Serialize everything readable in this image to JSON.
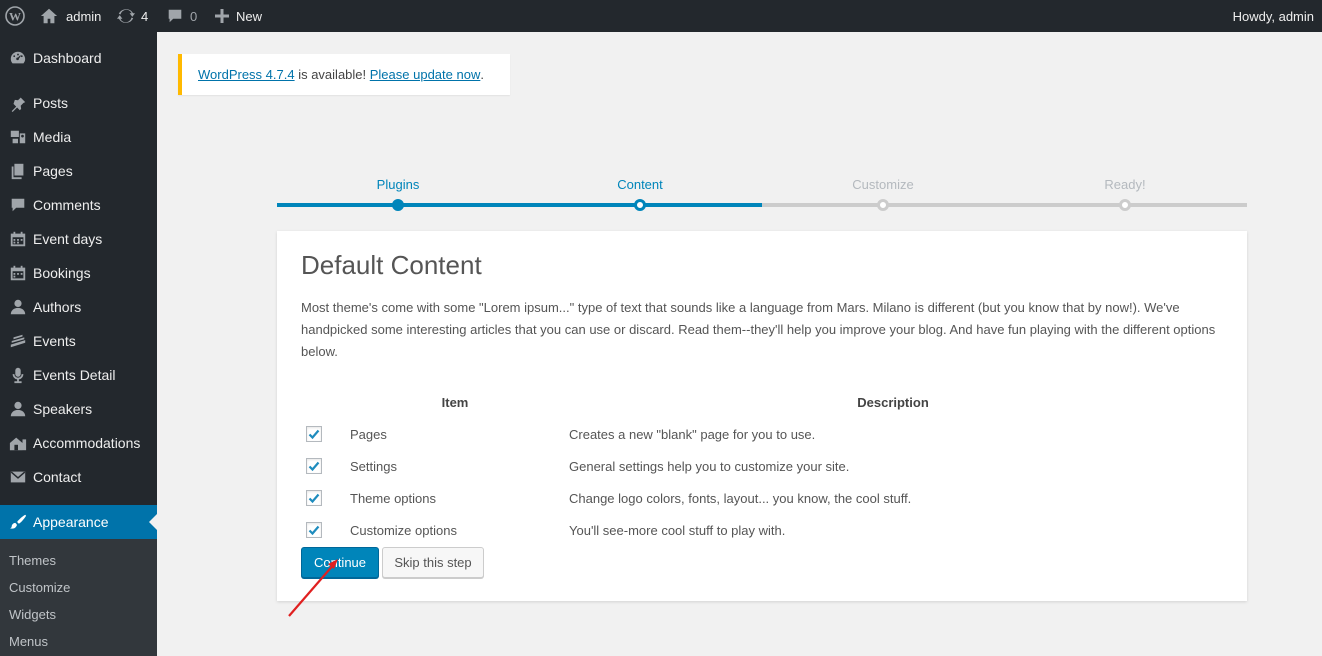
{
  "adminbar": {
    "site_name": "admin",
    "updates_count": "4",
    "comments_count": "0",
    "new_label": "New",
    "howdy": "Howdy, admin"
  },
  "sidebar": {
    "items": [
      {
        "label": "Dashboard",
        "icon": "dashboard-icon"
      },
      {
        "label": "Posts",
        "icon": "pushpin-icon"
      },
      {
        "label": "Media",
        "icon": "media-icon"
      },
      {
        "label": "Pages",
        "icon": "pages-icon"
      },
      {
        "label": "Comments",
        "icon": "comment-icon"
      },
      {
        "label": "Event days",
        "icon": "calendar-icon"
      },
      {
        "label": "Bookings",
        "icon": "calendar-icon"
      },
      {
        "label": "Authors",
        "icon": "user-icon"
      },
      {
        "label": "Events",
        "icon": "events-icon"
      },
      {
        "label": "Events Detail",
        "icon": "microphone-icon"
      },
      {
        "label": "Speakers",
        "icon": "user-icon"
      },
      {
        "label": "Accommodations",
        "icon": "accommodation-icon"
      },
      {
        "label": "Contact",
        "icon": "mail-icon"
      },
      {
        "label": "Appearance",
        "icon": "brush-icon",
        "active": true
      }
    ],
    "submenu": [
      "Themes",
      "Customize",
      "Widgets",
      "Menus"
    ]
  },
  "notice": {
    "link_version": "WordPress 4.7.4",
    "middle": " is available! ",
    "link_update": "Please update now",
    "end": "."
  },
  "steps": [
    {
      "label": "Plugins",
      "state": "done"
    },
    {
      "label": "Content",
      "state": "current"
    },
    {
      "label": "Customize",
      "state": "todo"
    },
    {
      "label": "Ready!",
      "state": "todo"
    }
  ],
  "card": {
    "title": "Default Content",
    "intro": "Most theme's come with some \"Lorem ipsum...\" type of text that sounds like a language from Mars. Milano is different (but you know that by now!). We've handpicked some interesting articles that you can use or discard. Read them--they'll help you improve your blog. And have fun playing with the different options below.",
    "col_item": "Item",
    "col_description": "Description",
    "rows": [
      {
        "item": "Pages",
        "description": "Creates a new \"blank\" page for you to use.",
        "checked": true
      },
      {
        "item": "Settings",
        "description": "General settings help you to customize your site.",
        "checked": true
      },
      {
        "item": "Theme options",
        "description": "Change logo colors, fonts, layout... you know, the cool stuff.",
        "checked": true
      },
      {
        "item": "Customize options",
        "description": "You'll see-more cool stuff to play with.",
        "checked": true
      }
    ],
    "continue_label": "Continue",
    "skip_label": "Skip this step"
  },
  "colors": {
    "accent": "#0085ba",
    "sidebar_bg": "#23282d",
    "notice_warning": "#ffb900",
    "annotation_arrow": "#e02020"
  }
}
